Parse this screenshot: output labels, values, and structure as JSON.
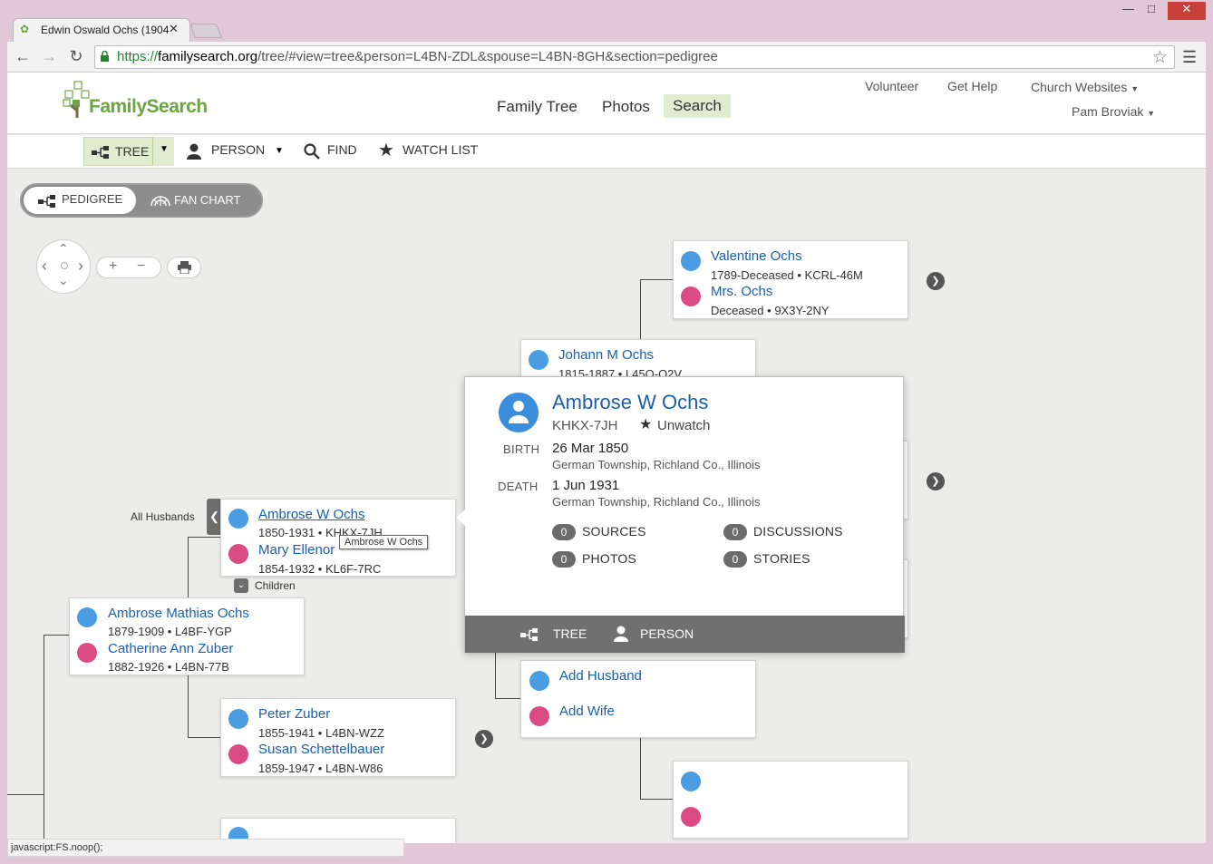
{
  "browser": {
    "tab_title": "Edwin Oswald Ochs (1904",
    "url_scheme": "https://",
    "url_host": "familysearch.org",
    "url_path": "/tree/#view=tree&person=L4BN-ZDL&spouse=L4BN-8GH&section=pedigree",
    "status_text": "javascript:FS.noop();"
  },
  "header": {
    "logo": "FamilySearch",
    "nav": [
      "Family Tree",
      "Photos",
      "Search"
    ],
    "util": [
      "Volunteer",
      "Get Help",
      "Church Websites",
      "Pam Broviak"
    ]
  },
  "subnav": {
    "tree": "TREE",
    "person": "PERSON",
    "find": "FIND",
    "watch": "WATCH LIST"
  },
  "view_toggle": {
    "pedigree": "PEDIGREE",
    "fan": "FAN CHART"
  },
  "cards": {
    "valentine": {
      "name": "Valentine Ochs",
      "meta": "1789-Deceased  •  KCRL-46M",
      "wife": "Mrs. Ochs",
      "wife_meta": "Deceased  •  9X3Y-2NY"
    },
    "johann": {
      "name": "Johann M Ochs",
      "meta": "1815-1887  •  L45Q-Q2V"
    },
    "ambrose_w": {
      "name": "Ambrose W Ochs",
      "meta": "1850-1931  •  KHKX-7JH",
      "wife": "Mary Ellenor",
      "wife_meta": "1854-1932  •  KL6F-7RC"
    },
    "ambrose_m": {
      "name": "Ambrose Mathias Ochs",
      "meta": "1879-1909  •  L4BF-YGP",
      "wife": "Catherine Ann Zuber",
      "wife_meta": "1882-1926  •  L4BN-77B"
    },
    "peter": {
      "name": "Peter Zuber",
      "meta": "1855-1941  •  L4BN-WZZ",
      "wife": "Susan Schettelbauer",
      "wife_meta": "1859-1947  •  L4BN-W86"
    },
    "add": {
      "husband": "Add Husband",
      "wife": "Add Wife"
    }
  },
  "all_husbands": "All Husbands",
  "children": "Children",
  "tooltip": "Ambrose W Ochs",
  "popup": {
    "name": "Ambrose W Ochs",
    "pid": "KHKX-7JH",
    "watch": "Unwatch",
    "birth_label": "BIRTH",
    "birth_date": "26 Mar 1850",
    "birth_place": "German Township, Richland Co., Illinois",
    "death_label": "DEATH",
    "death_date": "1 Jun 1931",
    "death_place": "German Township, Richland Co., Illinois",
    "sources_count": "0",
    "sources": "SOURCES",
    "discussions_count": "0",
    "discussions": "DISCUSSIONS",
    "photos_count": "0",
    "photos": "PHOTOS",
    "stories_count": "0",
    "stories": "STORIES",
    "footer_tree": "TREE",
    "footer_person": "PERSON"
  }
}
